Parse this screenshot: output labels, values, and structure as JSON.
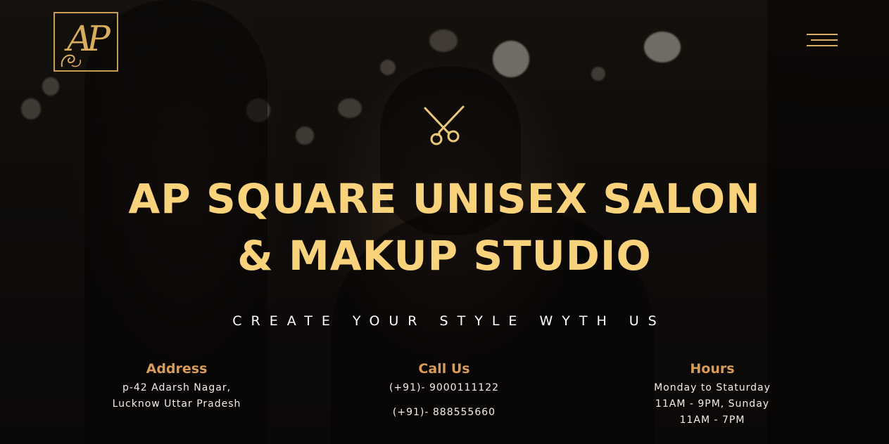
{
  "brand": {
    "logo_text": "AP",
    "logo_icon": "ap-monogram-logo",
    "accent_color": "#d9ad5e"
  },
  "header": {
    "menu_icon": "hamburger-menu-icon"
  },
  "hero": {
    "decor_icon": "scissors-icon",
    "title_line1": "AP SQUARE UNISEX SALON",
    "title_line2": "& MAKUP STUDIO",
    "tagline": "CREATE YOUR STYLE WYTH US",
    "title_color": "#f8d37c"
  },
  "info": {
    "address": {
      "heading": "Address",
      "line1": "p-42 Adarsh Nagar,",
      "line2": "Lucknow Uttar Pradesh"
    },
    "call": {
      "heading": "Call Us",
      "phone1": "(+91)- 9000111122",
      "phone2": "(+91)- 888555660"
    },
    "hours": {
      "heading": "Hours",
      "line1": "Monday to Staturday",
      "line2": "11AM - 9PM, Sunday",
      "line3": "11AM - 7PM"
    },
    "heading_color": "#d99c58"
  }
}
